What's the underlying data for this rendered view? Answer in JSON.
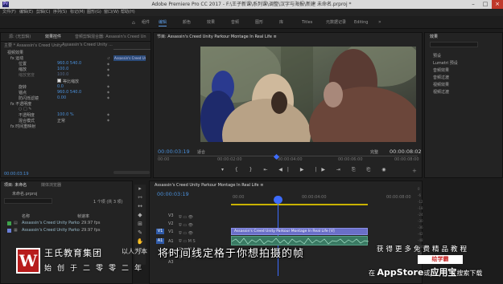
{
  "window": {
    "app_icon": "Pr",
    "title": "Adobe Premiere Pro CC 2017 - F:\\王子新课\\系列课\\调整\\汉字与海报\\新建 未命名.prproj *"
  },
  "menu": [
    "文件(F)",
    "编辑(E)",
    "剪辑(C)",
    "序列(S)",
    "标记(M)",
    "图形(G)",
    "窗口(W)",
    "帮助(H)"
  ],
  "workspaces": [
    "组件",
    "编辑",
    "颜色",
    "效果",
    "音频",
    "图形",
    "库",
    "Titles",
    "元数据记录",
    "Editing"
  ],
  "active_workspace": "编辑",
  "source_panel": {
    "tabs": [
      "源: (无剪辑)",
      "效果控件",
      "音频剪辑混合器: Assassin's Creed Un"
    ],
    "clip_header": "主要 * Assassin's Creed Unity ...",
    "seq_header": "Assassin's Creed Unity ...",
    "mini_clip": "Assassin's Creed Un",
    "rows": [
      {
        "label": "视频效果",
        "value": ""
      },
      {
        "label": "fx 运动",
        "value": ""
      },
      {
        "label": "位置",
        "value": "960.0   540.0"
      },
      {
        "label": "缩放",
        "value": "100.0"
      },
      {
        "label": "缩放宽度",
        "value": "100.0"
      },
      {
        "label": "",
        "value": ""
      },
      {
        "label": "旋转",
        "value": "0.0"
      },
      {
        "label": "锚点",
        "value": "960.0   540.0"
      },
      {
        "label": "防闪烁滤镜",
        "value": "0.00"
      },
      {
        "label": "fx 不透明度",
        "value": ""
      },
      {
        "label": "",
        "value": ""
      },
      {
        "label": "不透明度",
        "value": "100.0 %"
      },
      {
        "label": "混合模式",
        "value": "正常"
      },
      {
        "label": "fx 时间重映射",
        "value": ""
      }
    ],
    "uniform_scale": "等比缩放",
    "timecode": "00:00:03:19"
  },
  "program": {
    "tab": "节目: Assassin's Creed Unity Parkour Montage In Real Life    ≡",
    "timecode_left": "00:00:03:19",
    "fit": "适合",
    "quality": "完整",
    "timecode_right": "00:00:08:02",
    "ruler": [
      "00:00",
      "00:00:02:00",
      "00:00:04:00",
      "00:00:06:00",
      "00:00:08:00"
    ],
    "playhead": 0.45
  },
  "project": {
    "tabs": [
      "项目: 未命名",
      "媒体浏览器"
    ],
    "file": "未命名.prproj",
    "items_count": "1 个项 (共 3 项)",
    "col_name": "名称",
    "col_rate": "帧速率",
    "items": [
      {
        "name": "Assassin's Creed Unity Parko",
        "rate": "29.97 fps",
        "color": "#3fa34d"
      },
      {
        "name": "Assassin's Creed Unity Parko",
        "rate": "29.97 fps",
        "color": "#6a7fd8"
      }
    ]
  },
  "timeline": {
    "tab": "Assassin's Creed Unity Parkour Montage In Real Life    ≡",
    "timecode": "00:00:03:19",
    "ruler": [
      "00:00",
      "00:00:04:00",
      "00:00:08:00"
    ],
    "video_clip": "Assassin's Creed Unity Parkour Montage In Real Life [V]",
    "audio_clip": "",
    "tracks": [
      "V3",
      "V2",
      "V1",
      "A1",
      "A2",
      "A3"
    ],
    "playhead": 0.27
  },
  "effects_panel": {
    "tab": "效果",
    "items": [
      "预设",
      "Lumetri 预设",
      "音频效果",
      "音频过渡",
      "视频效果",
      "视频过渡"
    ]
  },
  "overlay": {
    "logo": "W",
    "company": "王氏教育集团",
    "slogan": "始创于二零零二年",
    "subtitle_prefix": "以人为本",
    "subtitle": "将时间线定格于你想拍摄的帧",
    "promo_line1": "获得更多免费精品教程",
    "promo_badge": "绘学霸",
    "promo_line2_a": "在",
    "promo_line2_b": "AppStore",
    "promo_line2_c": "或",
    "promo_line2_d": "应用宝",
    "promo_line2_e": "搜索下载"
  },
  "colors": {
    "accent": "#4a8fd9",
    "playhead": "#3d6cff",
    "logo_red": "#b71c1c"
  }
}
